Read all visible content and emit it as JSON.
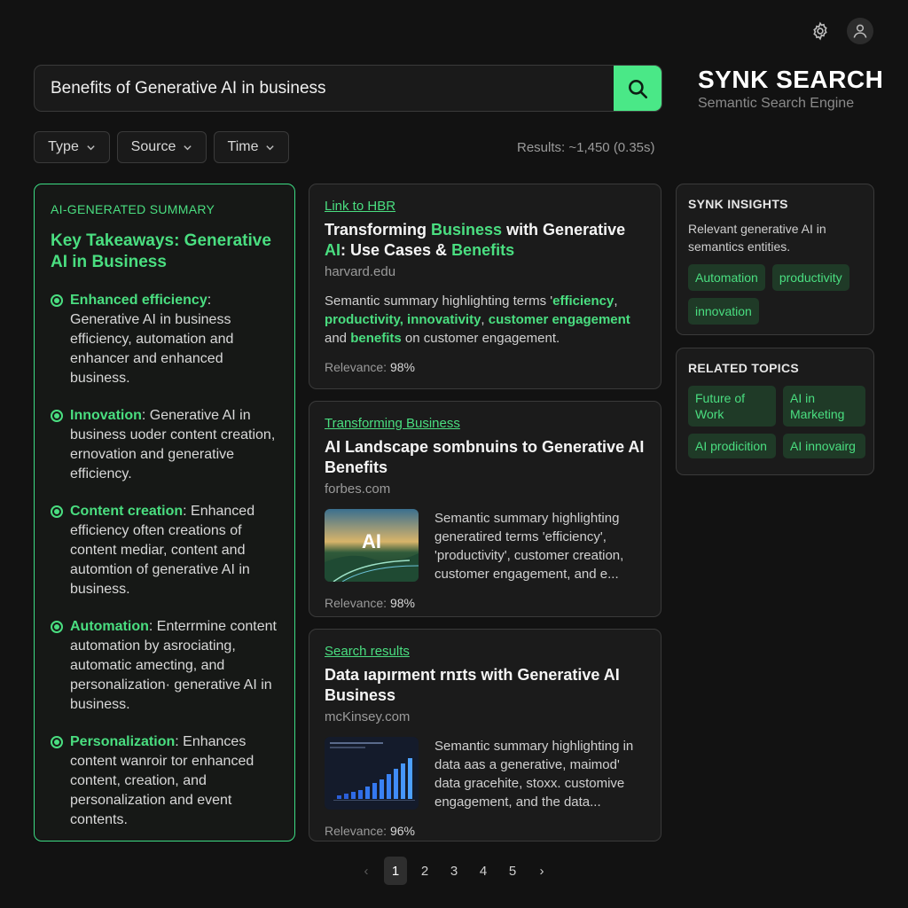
{
  "search": {
    "query": "Benefits of Generative AI in business"
  },
  "brand": {
    "name": "SYNK SEARCH",
    "tagline": "Semantic Search Engine"
  },
  "filters": {
    "type": "Type",
    "source": "Source",
    "time": "Time"
  },
  "results_count": "Results: ~1,450 (0.35s)",
  "summary": {
    "label": "AI-GENERATED SUMMARY",
    "title": "Key Takeaways: Generative AI in Business",
    "points": [
      {
        "head": "Enhanced efficiency",
        "sep": ":",
        "body": " Generative AI in business efficiency, automation and enhancer and enhanced business."
      },
      {
        "head": "Innovation",
        "sep": ":",
        "body": " Generative AI in business uoder content creation, ernovation and generative efficiency."
      },
      {
        "head": "Content creation",
        "sep": ":",
        "body": " Enhanced efficiency often creations of content mediar, content and automtion of generative AI in business."
      },
      {
        "head": "Automation",
        "sep": ":",
        "body": " Enterrmine content automation by asrociating, automatic amecting, and personalization· generative AI in business."
      },
      {
        "head": "Personalization",
        "sep": ":",
        "body": " Enhances content wanroir tor enhanced content, creation, and personalization and event contents."
      }
    ]
  },
  "results": [
    {
      "link": "Link to HBR",
      "title_parts": [
        "Transforming ",
        "Business",
        " with Generative ",
        "AI",
        ": Use Cases & ",
        "Benefits"
      ],
      "domain": "harvard.edu",
      "snippet_parts": [
        "Semantic summary highlighting terms '",
        "efficiency",
        ", ",
        "productivity, innovativity",
        ", ",
        "customer engagement",
        " and ",
        "benefits",
        " on customer engagement."
      ],
      "relevance_label": "Relevance: ",
      "relevance": "98%"
    },
    {
      "link": "Transforming Business",
      "title": "AI Landscape sombnuins to Generative AI Benefits",
      "domain": "forbes.com",
      "thumb_text": "AI",
      "snippet": "Semantic summary highlighting generatired terms 'efficiency', 'productivity', customer creation, customer engagement, and e...",
      "relevance_label": "Relevance: ",
      "relevance": "98%"
    },
    {
      "link": "Search results",
      "title": "Data ıapırment rnɪts with Generative AI Business",
      "domain": "mcKinsey.com",
      "snippet": "Semantic summary highlighting in data aas a generative, maimod' data gracehite, stoxx. customive engagement, and the data...",
      "relevance_label": "Relevance: ",
      "relevance": "96%"
    }
  ],
  "insights": {
    "title": "SYNK INSIGHTS",
    "text": "Relevant generative AI in semantics entities.",
    "chips": [
      "Automation",
      "productivity",
      "innovation"
    ]
  },
  "related": {
    "title": "RELATED TOPICS",
    "chips": [
      "Future of Work",
      "AI in Marketing",
      "AI prodicition",
      "AI innovairg"
    ]
  },
  "pagination": {
    "prev": "‹",
    "pages": [
      "1",
      "2",
      "3",
      "4",
      "5"
    ],
    "next": "›",
    "current": "1"
  },
  "colors": {
    "accent": "#4ade80",
    "button": "#4ae887",
    "background": "#121212",
    "card": "#1b1b1b"
  },
  "icons": {
    "settings": "gear-icon",
    "avatar": "user-icon",
    "search": "search-icon",
    "dropdown": "chevron-down-icon"
  }
}
